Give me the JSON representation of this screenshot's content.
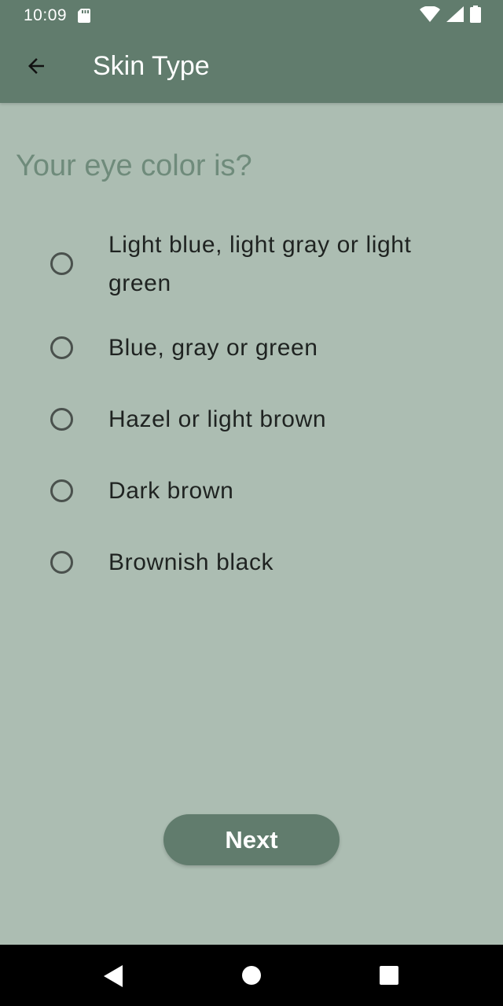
{
  "status_bar": {
    "time": "10:09",
    "icons": [
      "sd-card-icon",
      "wifi-icon",
      "cell-signal-icon",
      "battery-icon"
    ]
  },
  "app_bar": {
    "back_icon": "arrow-back-icon",
    "title": "Skin Type"
  },
  "question": "Your eye color is?",
  "options": [
    {
      "label": "Light blue, light gray or light green",
      "selected": false
    },
    {
      "label": "Blue, gray or green",
      "selected": false
    },
    {
      "label": "Hazel or light brown",
      "selected": false
    },
    {
      "label": "Dark brown",
      "selected": false
    },
    {
      "label": "Brownish black",
      "selected": false
    }
  ],
  "next_label": "Next",
  "nav_bar": {
    "icons": [
      "nav-back-icon",
      "nav-home-icon",
      "nav-recents-icon"
    ]
  },
  "colors": {
    "primary": "#617C6D",
    "background": "#ACBDB2",
    "question_text": "#6F8B7B",
    "option_text": "#1F2321"
  }
}
